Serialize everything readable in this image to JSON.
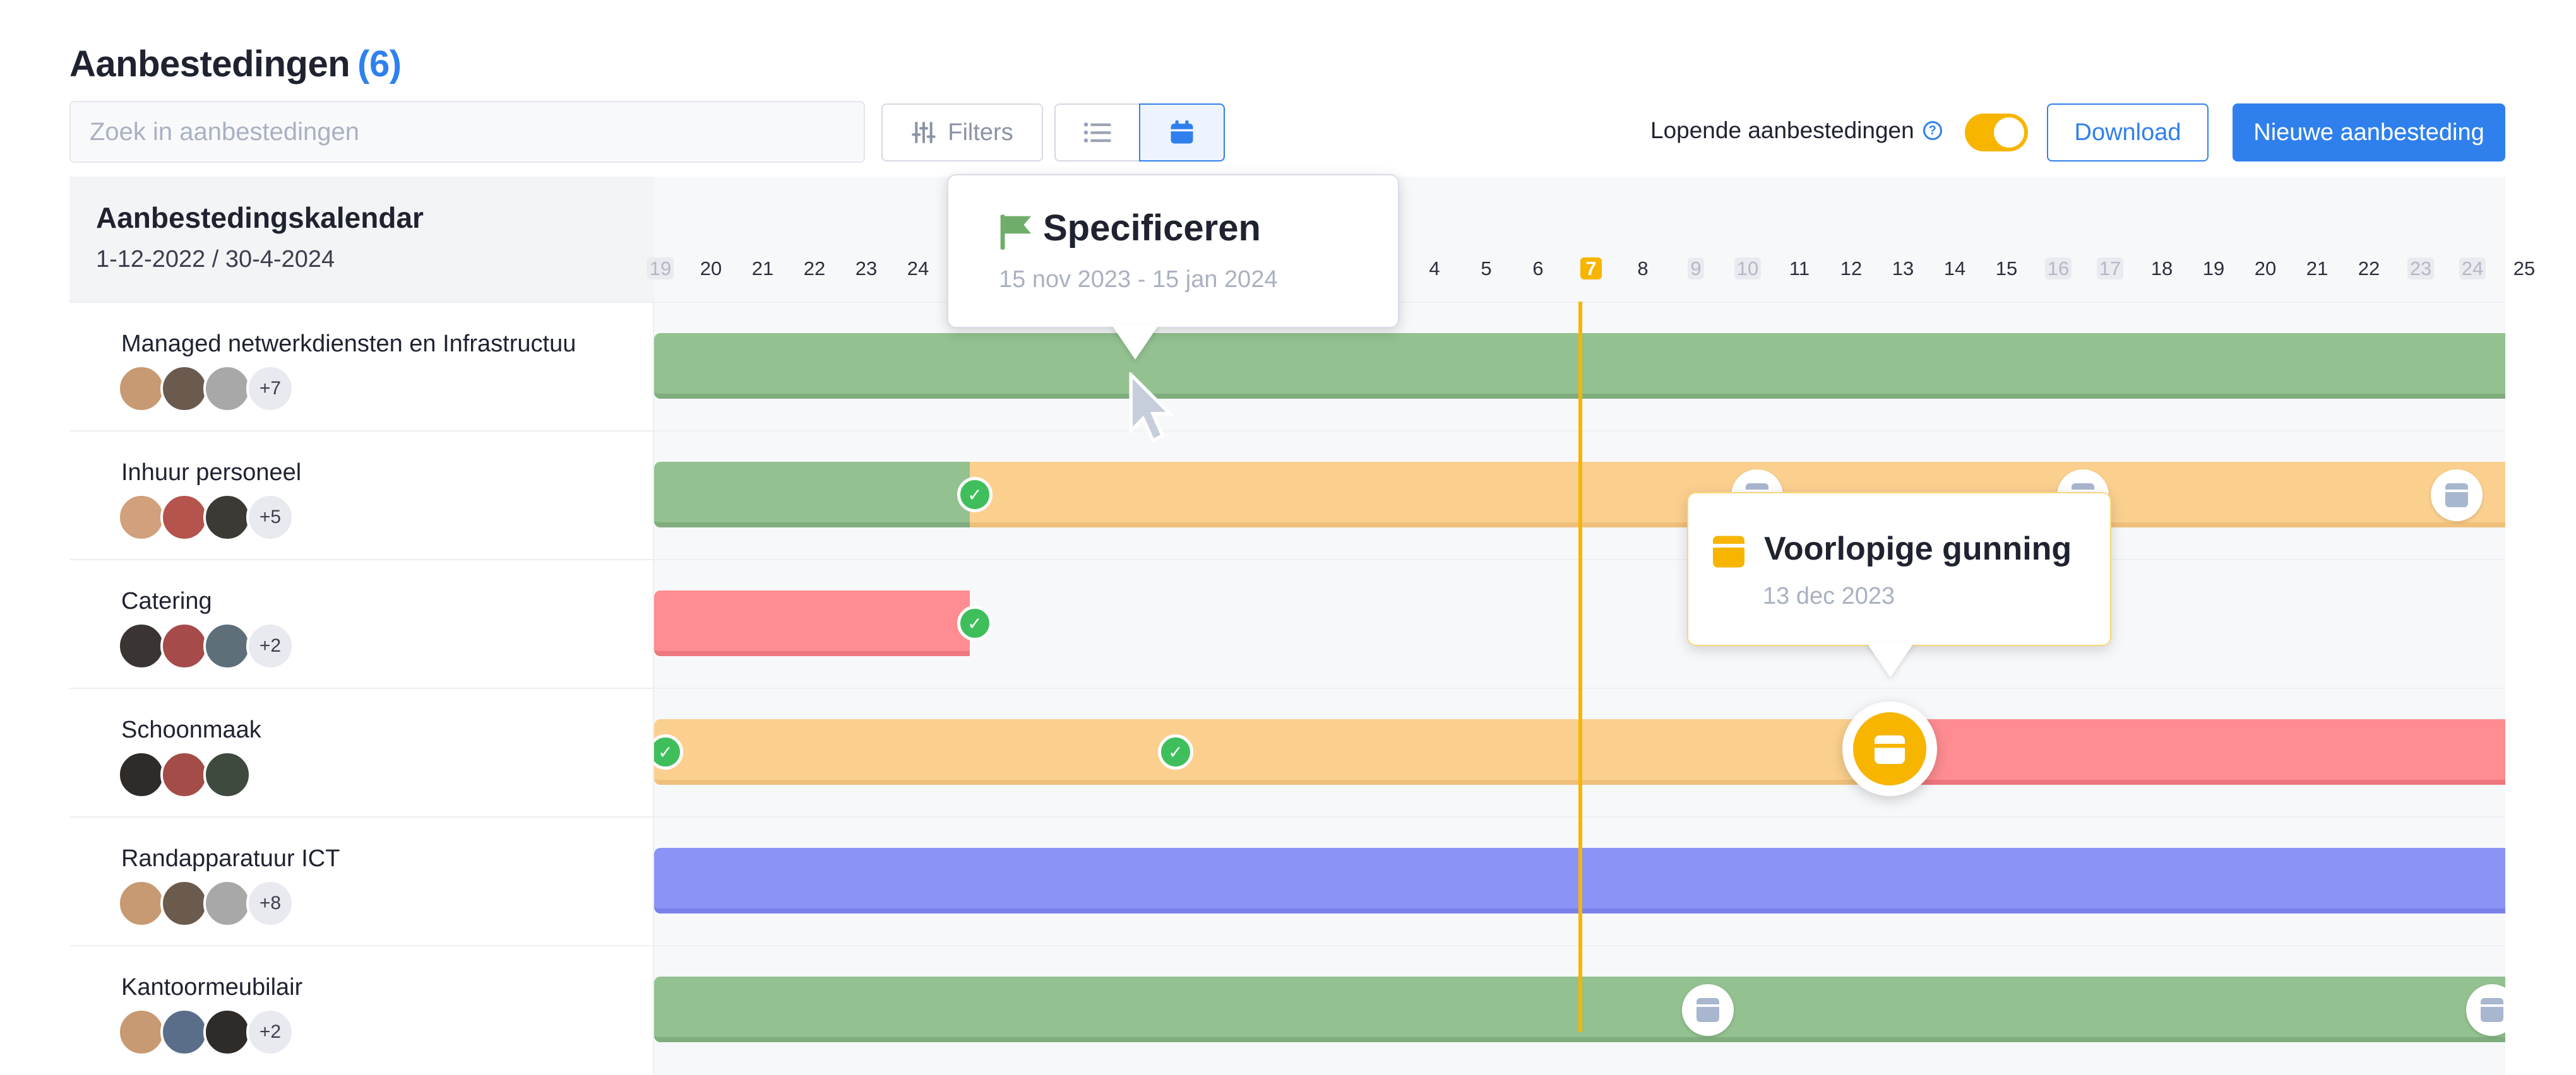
{
  "header": {
    "title": "Aanbestedingen",
    "count": "(6)",
    "search_placeholder": "Zoek in aanbestedingen",
    "filters_label": "Filters",
    "lopende_label": "Lopende aanbestedingen",
    "lopende_enabled": true,
    "download_label": "Download",
    "new_label": "Nieuwe aanbesteding"
  },
  "calendar": {
    "title": "Aanbestedingskalendar",
    "range": "1-12-2022 / 30-4-2024",
    "days": [
      {
        "label": "19",
        "weekend": true
      },
      {
        "label": "20"
      },
      {
        "label": "21"
      },
      {
        "label": "22"
      },
      {
        "label": "23"
      },
      {
        "label": "24"
      },
      {
        "label": "4"
      },
      {
        "label": "5"
      },
      {
        "label": "6"
      },
      {
        "label": "7",
        "today": true
      },
      {
        "label": "8"
      },
      {
        "label": "9",
        "weekend": true
      },
      {
        "label": "10",
        "weekend": true
      },
      {
        "label": "11"
      },
      {
        "label": "12"
      },
      {
        "label": "13"
      },
      {
        "label": "14"
      },
      {
        "label": "15"
      },
      {
        "label": "16",
        "weekend": true
      },
      {
        "label": "17",
        "weekend": true
      },
      {
        "label": "18"
      },
      {
        "label": "19"
      },
      {
        "label": "20"
      },
      {
        "label": "21"
      },
      {
        "label": "22"
      },
      {
        "label": "23",
        "weekend": true
      },
      {
        "label": "24",
        "weekend": true
      },
      {
        "label": "25"
      }
    ],
    "rows": [
      {
        "name": "Managed netwerkdiensten en Infrastructuu",
        "more": "+7"
      },
      {
        "name": "Inhuur personeel",
        "more": "+5"
      },
      {
        "name": "Catering",
        "more": "+2"
      },
      {
        "name": "Schoonmaak",
        "more": ""
      },
      {
        "name": "Randapparatuur ICT",
        "more": "+8"
      },
      {
        "name": "Kantoormeubilair",
        "more": "+2"
      }
    ]
  },
  "tooltips": {
    "phase": {
      "title": "Specificeren",
      "dates": "15 nov 2023 - 15 jan 2024"
    },
    "milestone": {
      "title": "Voorlopige gunning",
      "date": "13 dec 2023"
    }
  },
  "colors": {
    "accent": "#2f80ed",
    "today": "#f7b500",
    "green": "#93c190",
    "orange": "#fbd08f",
    "red": "#fe8c91",
    "blue": "#8b93f7",
    "check": "#3fbf5b"
  }
}
